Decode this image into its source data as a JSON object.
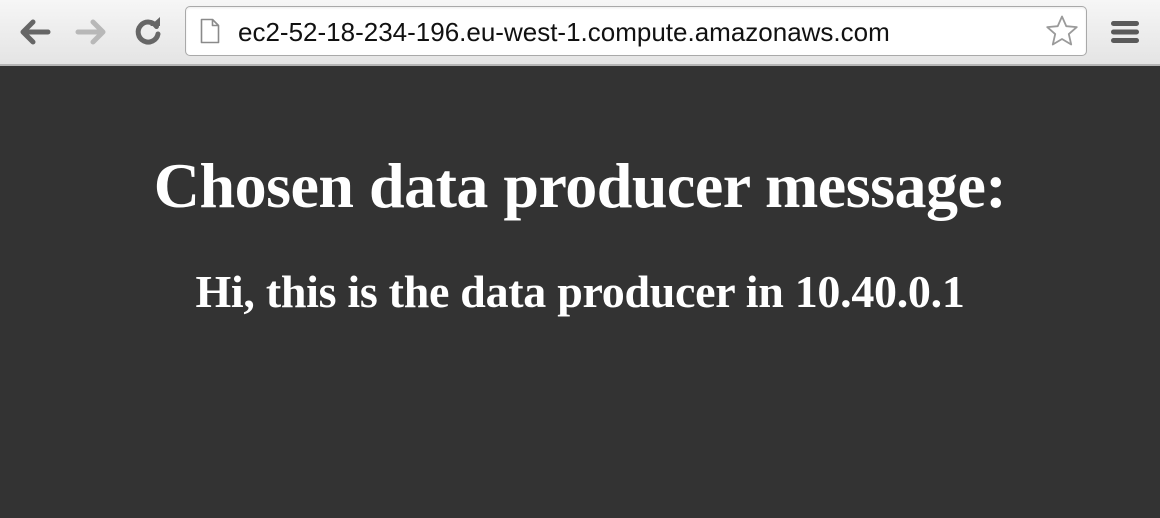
{
  "browser": {
    "address_bar": {
      "url": "ec2-52-18-234-196.eu-west-1.compute.amazonaws.com"
    },
    "icons": {
      "back": "back-arrow-icon",
      "forward": "forward-arrow-icon",
      "reload": "reload-icon",
      "page": "page-icon",
      "bookmark": "star-icon",
      "menu": "hamburger-menu-icon"
    },
    "colors": {
      "toolbar": "#ececec",
      "page_background": "#333333",
      "page_text": "#ffffff"
    }
  },
  "page": {
    "heading": "Chosen data producer message:",
    "message": "Hi, this is the data producer in 10.40.0.1"
  }
}
